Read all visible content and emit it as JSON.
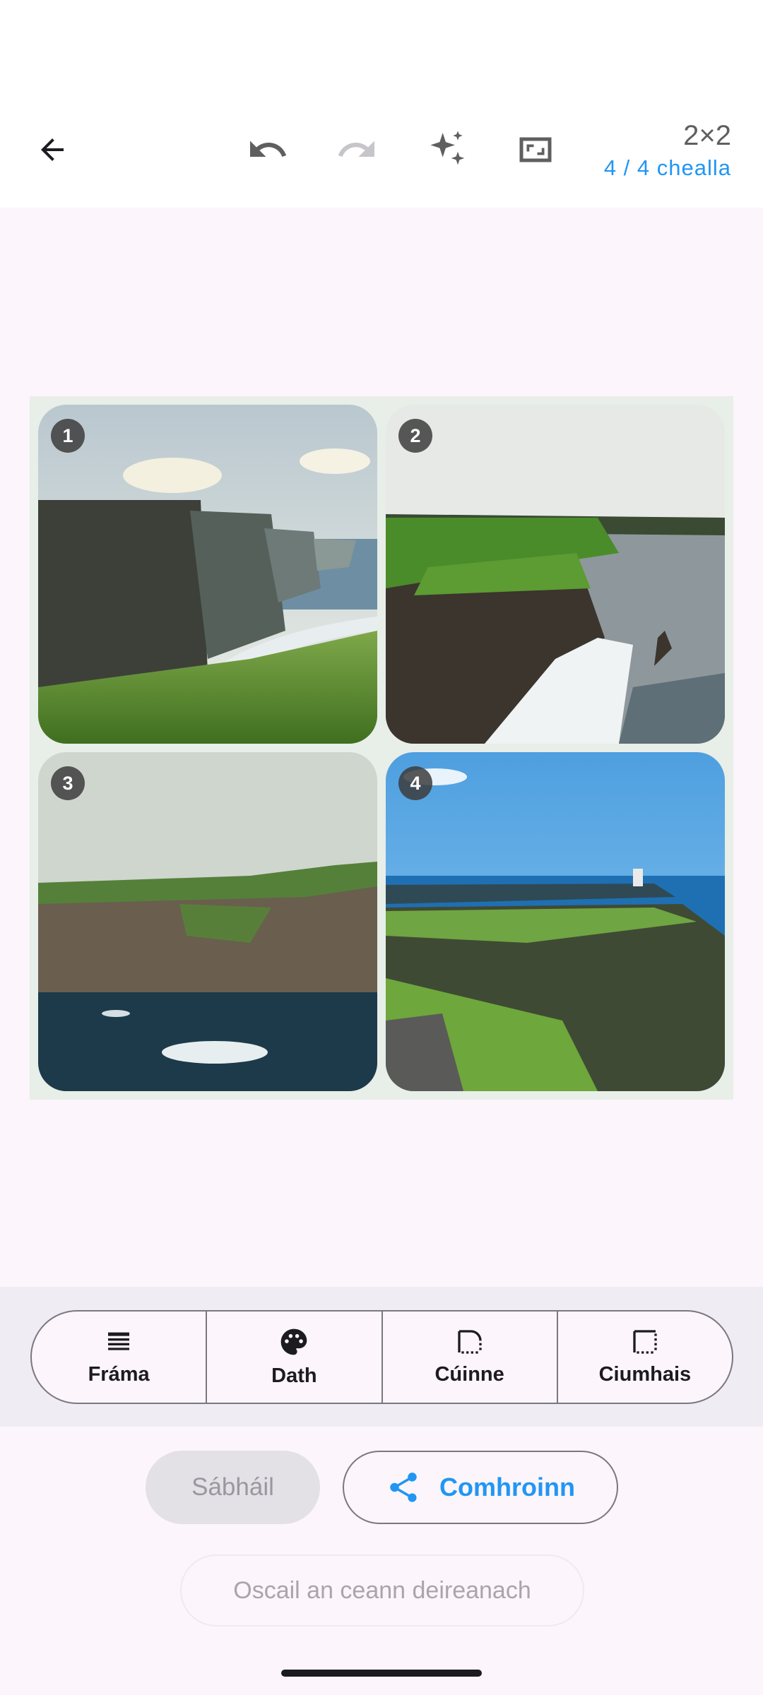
{
  "toolbar": {
    "back_icon": "arrow-left-icon",
    "undo_icon": "undo-icon",
    "redo_icon": "redo-icon",
    "magic_icon": "sparkle-icon",
    "fit_icon": "fit-screen-icon",
    "grid_size": "2×2",
    "cell_count": "4 / 4 chealla"
  },
  "collage": {
    "cells": [
      {
        "number": "1",
        "scene": "cliffs with sunburst over green grass"
      },
      {
        "number": "2",
        "scene": "cliffs over sea with sea stack"
      },
      {
        "number": "3",
        "scene": "cliff wall above dark sea"
      },
      {
        "number": "4",
        "scene": "cliff top with tower under blue sky"
      }
    ]
  },
  "tools": [
    {
      "label": "Fráma",
      "icon": "frame-icon"
    },
    {
      "label": "Dath",
      "icon": "palette-icon"
    },
    {
      "label": "Cúinne",
      "icon": "corner-icon"
    },
    {
      "label": "Ciumhais",
      "icon": "border-icon"
    }
  ],
  "actions": {
    "save_label": "Sábháil",
    "share_label": "Comhroinn",
    "open_last_label": "Oscail an ceann deireanach"
  },
  "colors": {
    "accent": "#2196f3",
    "background": "#fcf5fb",
    "collage_frame": "#e8eee8"
  }
}
